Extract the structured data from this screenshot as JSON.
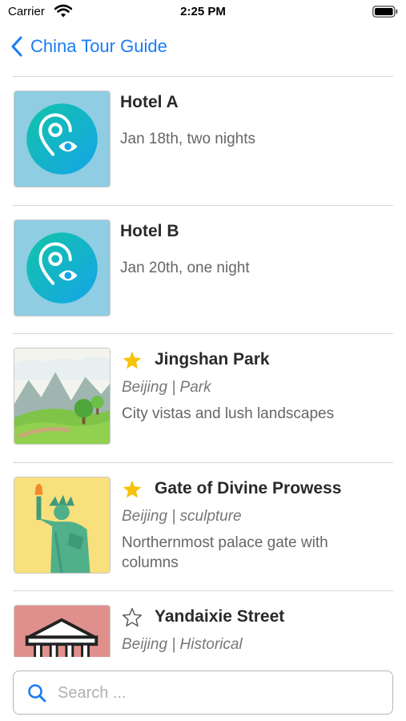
{
  "status_bar": {
    "carrier": "Carrier",
    "time": "2:25 PM"
  },
  "nav": {
    "back_label": "China Tour Guide"
  },
  "items": [
    {
      "title": "Hotel A",
      "subtitle": "Jan 18th, two nights",
      "icon": "location-pin-eye-icon"
    },
    {
      "title": "Hotel B",
      "subtitle": "Jan 20th, one night",
      "icon": "location-pin-eye-icon"
    },
    {
      "title": "Jingshan Park",
      "meta": "Beijing | Park",
      "description": "City vistas and lush landscapes",
      "favorite": true,
      "icon": "park-landscape-image"
    },
    {
      "title": "Gate of Divine Prowess",
      "meta": "Beijing | sculpture",
      "description": "Northernmost palace gate with columns",
      "favorite": true,
      "icon": "statue-image"
    },
    {
      "title": "Yandaixie Street",
      "meta": "Beijing | Historical",
      "description": "",
      "favorite": false,
      "icon": "temple-building-image"
    }
  ],
  "search": {
    "placeholder": "Search ..."
  },
  "colors": {
    "accent": "#1a7cf4",
    "star": "#f7c30a",
    "hotel_tile": "#8fcde3",
    "divider": "#d6d6d6"
  }
}
